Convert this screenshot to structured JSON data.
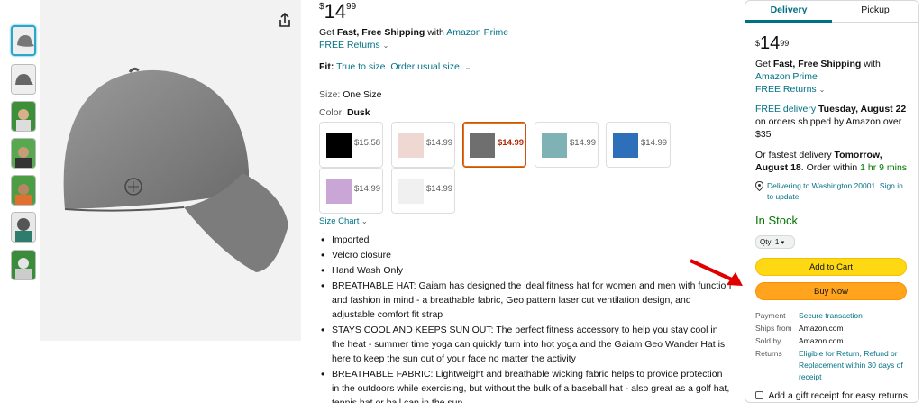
{
  "center": {
    "price_symbol": "$",
    "price_whole": "14",
    "price_fraction": "99",
    "shipping_prefix": "Get ",
    "shipping_bold": "Fast, Free Shipping",
    "shipping_mid": " with ",
    "shipping_link": "Amazon Prime",
    "free_returns": "FREE Returns",
    "fit_label": "Fit:",
    "fit_value": "True to size. Order usual size.",
    "size_label": "Size:",
    "size_value": "One Size",
    "color_label": "Color:",
    "color_value": "Dusk",
    "swatches": [
      {
        "price": "$15.58",
        "color": "#000000"
      },
      {
        "price": "$14.99",
        "color": "#efd8d2"
      },
      {
        "price": "$14.99",
        "color": "#6f6f6f"
      },
      {
        "price": "$14.99",
        "color": "#7fb2b5"
      },
      {
        "price": "$14.99",
        "color": "#2d6fb8"
      },
      {
        "price": "$14.99",
        "color": "#c9a6d6"
      },
      {
        "price": "$14.99",
        "color": "#f0f0f0"
      }
    ],
    "size_chart": "Size Chart",
    "bullets": [
      "Imported",
      "Velcro closure",
      "Hand Wash Only",
      "BREATHABLE HAT: Gaiam has designed the ideal fitness hat for women and men with function and fashion in mind - a breathable fabric, Geo pattern laser cut ventilation design, and adjustable comfort fit strap",
      "STAYS COOL AND KEEPS SUN OUT: The perfect fitness accessory to help you stay cool in the heat - summer time yoga can quickly turn into hot yoga and the Gaiam Geo Wander Hat is here to keep the sun out of your face no matter the activity",
      "BREATHABLE FABRIC: Lightweight and breathable wicking fabric helps to provide protection in the outdoors while exercising, but without the bulk of a baseball hat - also great as a golf hat, tennis hat or ball cap in the sun"
    ]
  },
  "buybox": {
    "tab_delivery": "Delivery",
    "tab_pickup": "Pickup",
    "price_symbol": "$",
    "price_whole": "14",
    "price_fraction": "99",
    "ship_prefix": "Get ",
    "ship_bold": "Fast, Free Shipping",
    "ship_mid": " with",
    "ship_link": "Amazon Prime",
    "free_returns": "FREE Returns",
    "free_delivery_link": "FREE delivery",
    "delivery_date": "Tuesday, August 22",
    "delivery_cond": "on orders shipped by Amazon over $35",
    "fastest_prefix": "Or fastest delivery ",
    "fastest_date_1": "Tomorrow,",
    "fastest_date_2": "August 18",
    "order_within": ". Order within ",
    "countdown": "1 hr 9 mins",
    "location": "Delivering to Washington 20001. Sign in to update",
    "stock": "In Stock",
    "qty": "Qty: 1",
    "add_to_cart": "Add to Cart",
    "buy_now": "Buy Now",
    "payment_k": "Payment",
    "payment_v": "Secure transaction",
    "ships_k": "Ships from",
    "ships_v": "Amazon.com",
    "sold_k": "Sold by",
    "sold_v": "Amazon.com",
    "returns_k": "Returns",
    "returns_v": "Eligible for Return, Refund or Replacement within 30 days of receipt",
    "gift": "Add a gift receipt for easy returns"
  },
  "colors": {
    "accent_link": "#007185",
    "add_to_cart": "#ffd814",
    "buy_now": "#ffa41c",
    "in_stock": "#007600",
    "annotation_arrow": "#e00000"
  }
}
